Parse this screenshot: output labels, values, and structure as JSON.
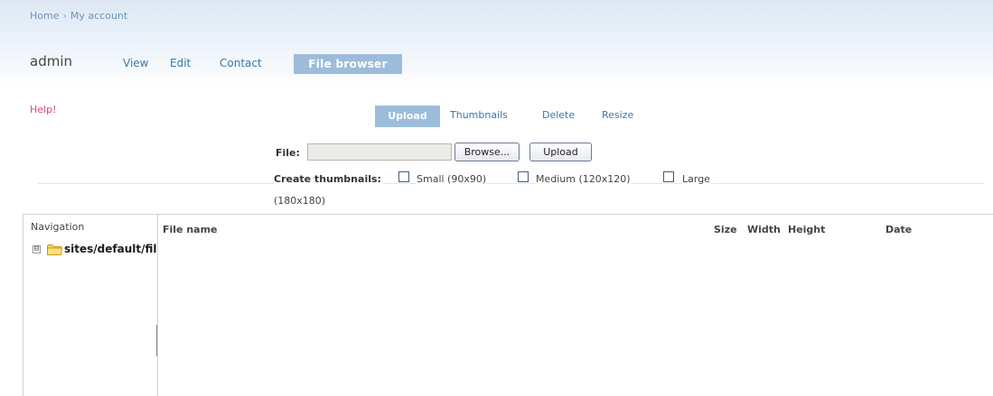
{
  "breadcrumb": {
    "home": "Home",
    "separator": "›",
    "current": "My account"
  },
  "user": {
    "name": "admin"
  },
  "tabs": [
    {
      "label": "View"
    },
    {
      "label": "Edit"
    },
    {
      "label": "Contact"
    },
    {
      "label": "File browser",
      "active": true
    }
  ],
  "help": {
    "label": "Help!"
  },
  "subtabs": [
    {
      "label": "Upload",
      "active": true
    },
    {
      "label": "Thumbnails"
    },
    {
      "label": "Delete"
    },
    {
      "label": "Resize"
    }
  ],
  "upload": {
    "file_label": "File:",
    "file_value": "",
    "browse_label": "Browse...",
    "upload_label": "Upload",
    "thumbs_label": "Create thumbnails:",
    "options": [
      {
        "label": "Small (90x90)",
        "checked": false
      },
      {
        "label": "Medium (120x120)",
        "checked": false
      },
      {
        "label": "Large",
        "checked": false
      }
    ],
    "large_wrap": "(180x180)"
  },
  "navigation": {
    "title": "Navigation",
    "tree": [
      {
        "toggle": "⊟",
        "label": "sites/default/files",
        "icon": "folder-icon"
      }
    ]
  },
  "file_table": {
    "columns": [
      "File name",
      "Size",
      "Width",
      "Height",
      "Date"
    ],
    "rows": []
  },
  "colors": {
    "accent": "#9dbcdb",
    "link": "#3b77a8",
    "help": "#d64b6d",
    "header_band": "#dde8f4"
  }
}
